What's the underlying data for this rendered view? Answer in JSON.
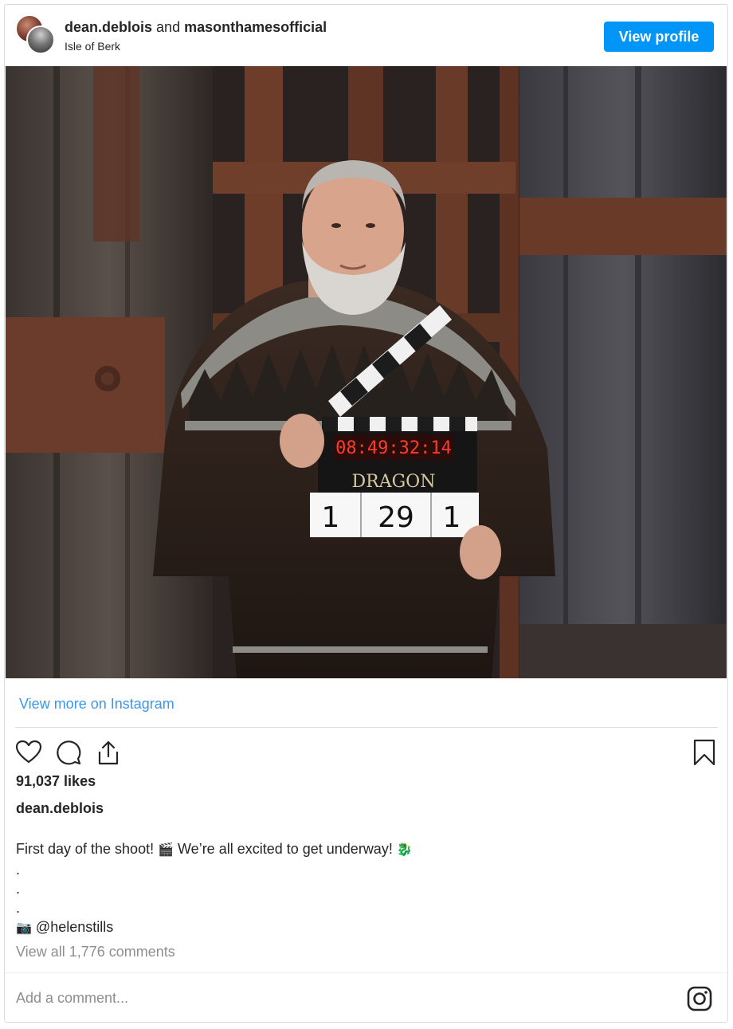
{
  "header": {
    "user1": "dean.deblois",
    "conjunction": "and",
    "user2": "masonthamesofficial",
    "location": "Isle of Berk",
    "view_profile_label": "View profile"
  },
  "photo": {
    "clapper_timecode": "08:49:32:14",
    "clapper_title": "DRAGON",
    "clapper_slate": [
      "1",
      "29",
      "1"
    ]
  },
  "view_more_label": "View more on Instagram",
  "actions": {
    "icons": [
      "heart-icon",
      "comment-icon",
      "share-icon",
      "bookmark-icon"
    ]
  },
  "likes_text": "91,037 likes",
  "owner_username": "dean.deblois",
  "caption": {
    "text1": "First day of the shoot! ",
    "emoji1": "🎬",
    "text2": " We’re all excited to get underway! ",
    "emoji2": "🐉",
    "dots": [
      ".",
      ".",
      "."
    ],
    "credit_emoji": "📷",
    "credit": " @helenstills"
  },
  "comments_link": "View all 1,776 comments",
  "add_comment_placeholder": "Add a comment...",
  "colors": {
    "accent": "#0095f6",
    "link": "#3897f0",
    "muted": "#8e8e8e"
  }
}
